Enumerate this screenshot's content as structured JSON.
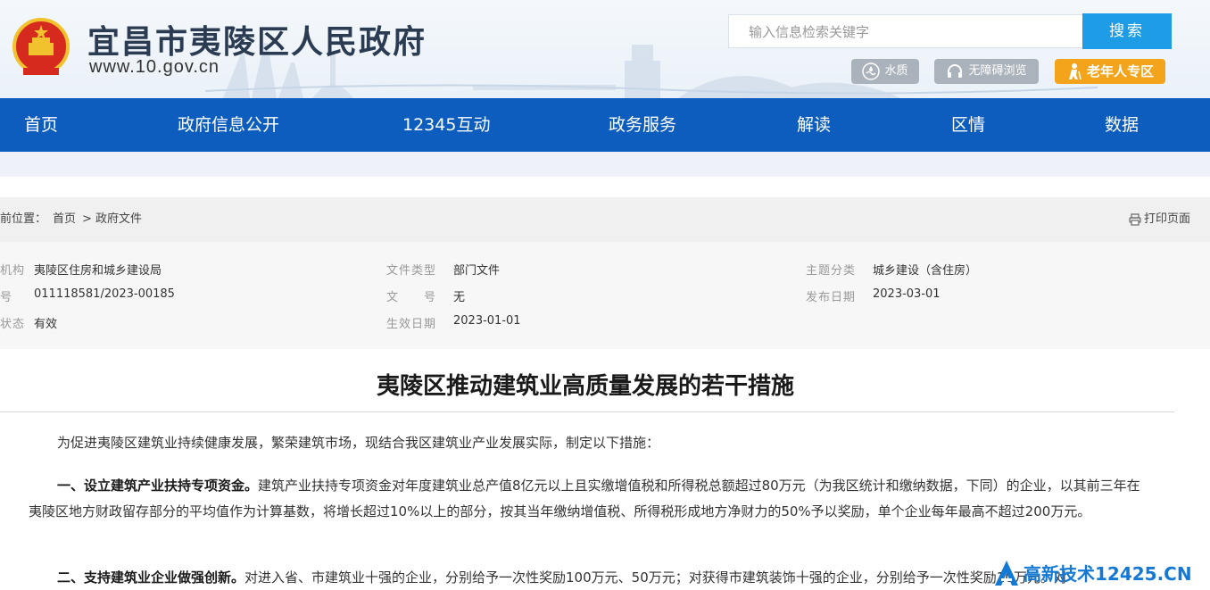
{
  "header": {
    "site_title": "宜昌市夷陵区人民政府",
    "site_url": "www.10.gov.cn",
    "search_placeholder": "输入信息检索关键字",
    "search_button": "搜索",
    "tools": {
      "water": "水质",
      "accessible": "无障碍浏览",
      "elder": "老年人专区"
    }
  },
  "nav": [
    "首页",
    "政府信息公开",
    "12345互动",
    "政务服务",
    "解读",
    "区情",
    "数据"
  ],
  "breadcrumb": {
    "label": "前位置：",
    "home": "首页",
    "separator": ">",
    "current": "政府文件",
    "print": "打印页面"
  },
  "meta": {
    "row1": {
      "k1": "机构",
      "v1": "夷陵区住房和城乡建设局",
      "k2": "文件类型",
      "v2": "部门文件",
      "k3": "主题分类",
      "v3": "城乡建设（含住房）"
    },
    "row2": {
      "k1": "号",
      "v1": "011118581/2023-00185",
      "k2": "文　　号",
      "v2": "无",
      "k3": "发布日期",
      "v3": "2023-03-01"
    },
    "row3": {
      "k1": "状态",
      "v1": "有效",
      "k2": "生效日期",
      "v2": "2023-01-01"
    }
  },
  "article": {
    "title": "夷陵区推动建筑业高质量发展的若干措施",
    "intro": "为促进夷陵区建筑业持续健康发展，繁荣建筑市场，现结合我区建筑业产业发展实际，制定以下措施：",
    "p1_head": "一、设立建筑产业扶持专项资金。",
    "p1_body": "建筑产业扶持专项资金对年度建筑业总产值8亿元以上且实缴增值税和所得税总额超过80万元（为我区统计和缴纳数据，下同）的企业，以其前三年在夷陵区地方财政留存部分的平均值作为计算基数，将增长超过10%以上的部分，按其当年缴纳增值税、所得税形成地方净财力的50%予以奖励，单个企业每年最高不超过200万元。",
    "p2_head": "二、支持建筑业企业做强创新。",
    "p2_body": "对进入省、市建筑业十强的企业，分别给予一次性奖励100万元、50万元；对获得市建筑装饰十强的企业，分别给予一次性奖励10万元。对"
  },
  "watermark": "高新技术12425.CN",
  "colors": {
    "nav": "#0d5dbf",
    "search": "#1e9ce6",
    "elder": "#f3a41a"
  }
}
